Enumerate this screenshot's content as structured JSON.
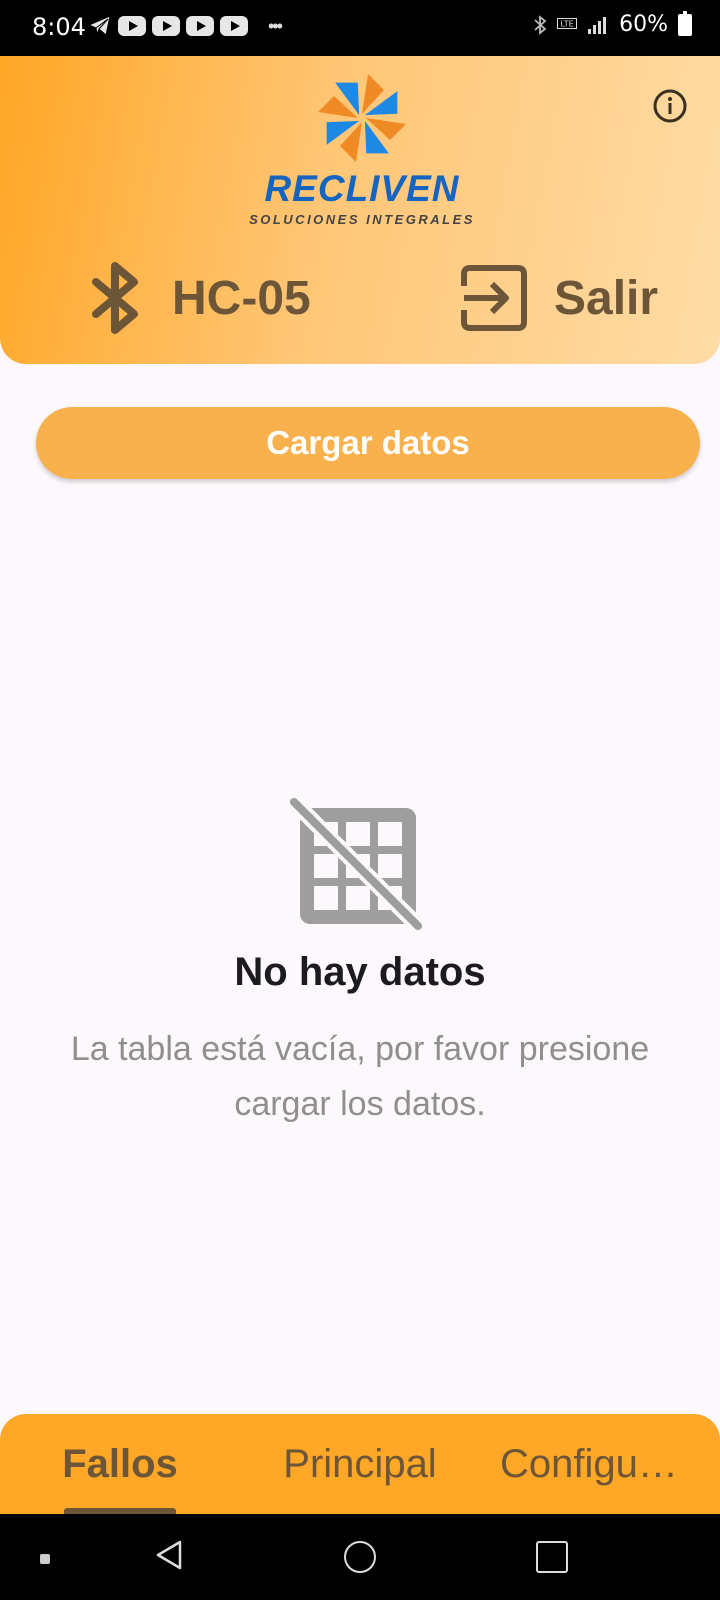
{
  "status_bar": {
    "time": "8:04",
    "battery": "60%",
    "icons": [
      "telegram-icon",
      "youtube-icon",
      "youtube-icon",
      "youtube-icon",
      "youtube-icon",
      "more-icon",
      "bluetooth-icon",
      "lte-icon",
      "signal-icon",
      "battery-icon"
    ]
  },
  "header": {
    "logo_name": "RECLIVEN",
    "logo_tagline": "SOLUCIONES INTEGRALES",
    "device_name": "HC-05",
    "exit_label": "Salir",
    "colors": {
      "brand_blue": "#1565c0",
      "brand_orange": "#f08a24",
      "gradient_start": "#ffa726",
      "gradient_end": "#ffdca6"
    }
  },
  "main": {
    "load_button_label": "Cargar datos",
    "empty_title": "No hay datos",
    "empty_description": "La tabla está vacía, por favor presione cargar los datos."
  },
  "tabs": [
    {
      "label": "Fallos",
      "active": true
    },
    {
      "label": "Principal",
      "active": false
    },
    {
      "label": "Configu…",
      "active": false
    }
  ],
  "colors": {
    "accent": "#ffa726",
    "text_dark": "#6d5537",
    "button": "#f8b14c",
    "background": "#fdf8fc"
  }
}
